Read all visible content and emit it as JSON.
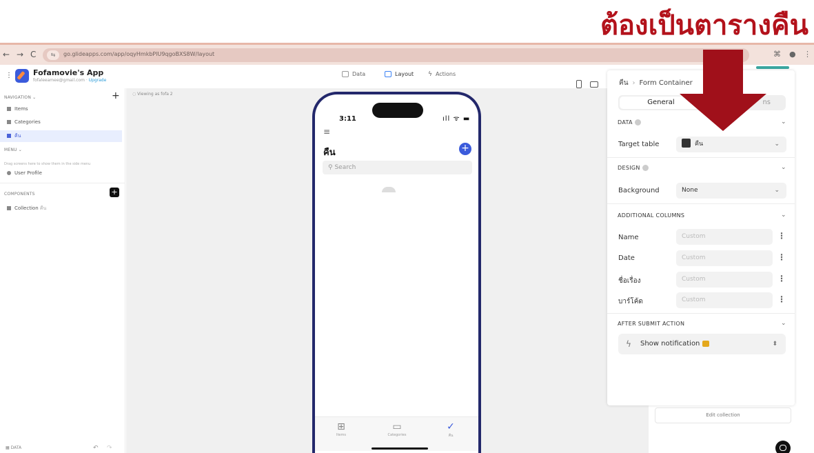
{
  "annotation": {
    "text": "ต้องเป็นตารางคืน"
  },
  "browser": {
    "back": "←",
    "forward": "→",
    "reload": "C",
    "site_icon": "⇆",
    "url": "go.glideapps.com/app/oqyHmkbPlU9qgoBXS8W/layout"
  },
  "app": {
    "title": "Fofamovie's App",
    "email": "fofaleeamee@gmail.com",
    "upgrade": "Upgrade",
    "tabs": [
      {
        "label": "Data"
      },
      {
        "label": "Layout"
      },
      {
        "label": "Actions"
      }
    ]
  },
  "sidebar": {
    "navigation_title": "NAVIGATION",
    "navigation_items": [
      {
        "label": "Items"
      },
      {
        "label": "Categories"
      },
      {
        "label": "คืน"
      }
    ],
    "menu_title": "MENU",
    "menu_hint": "Drag screens here to show them in the side menu",
    "menu_items": [
      {
        "label": "User Profile"
      }
    ],
    "components_title": "COMPONENTS",
    "components_items": [
      {
        "label": "Collection",
        "sub": "คืน"
      }
    ],
    "footer_label": "DATA"
  },
  "canvas": {
    "viewing_as": "Viewing as fofa 2"
  },
  "phone": {
    "time": "3:11",
    "status_icons": "ıll ᯤ ▬",
    "title": "คืน",
    "search_placeholder": "Search",
    "tabs": [
      {
        "label": "Items",
        "glyph": "⊞"
      },
      {
        "label": "Categories",
        "glyph": "▭"
      },
      {
        "label": "คืน",
        "glyph": "✓"
      }
    ]
  },
  "panel": {
    "breadcrumb_parent": "คืน",
    "breadcrumb_current": "Form Container",
    "seg_general": "General",
    "seg_other": "ns",
    "data_section": "DATA",
    "target_table_label": "Target table",
    "target_table_value": "คืน",
    "design_section": "DESIGN",
    "background_label": "Background",
    "background_value": "None",
    "additional_columns_section": "ADDITIONAL COLUMNS",
    "columns": [
      {
        "label": "Name",
        "value": "Custom"
      },
      {
        "label": "Date",
        "value": "Custom"
      },
      {
        "label": "ชื่อเรื่อง",
        "value": "Custom"
      },
      {
        "label": "บาร์โค้ด",
        "value": "Custom"
      }
    ],
    "after_submit_section": "AFTER SUBMIT ACTION",
    "after_submit_value": "Show notification"
  },
  "edit_collection": "Edit collection",
  "colors": {
    "accent": "#3b5bdb",
    "annotation_red": "#a0101a"
  }
}
